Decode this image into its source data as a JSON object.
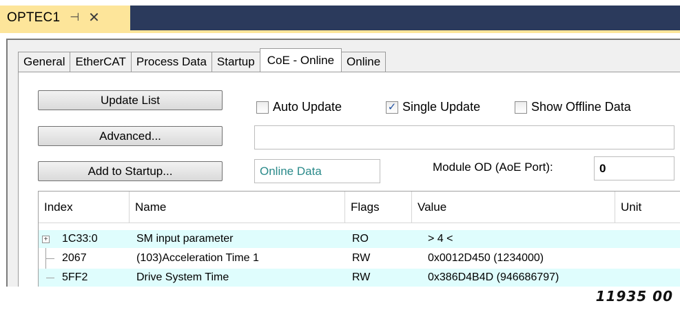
{
  "window": {
    "title": "OPTEC1",
    "pin_glyph": "⊣",
    "close_glyph": "✕"
  },
  "tabs": [
    "General",
    "EtherCAT",
    "Process Data",
    "Startup",
    "CoE - Online",
    "Online"
  ],
  "active_tab": "CoE - Online",
  "buttons": {
    "update_list": "Update List",
    "advanced": "Advanced...",
    "add_to_startup": "Add to Startup..."
  },
  "checkboxes": [
    {
      "label": "Auto Update",
      "checked": false
    },
    {
      "label": "Single Update",
      "checked": true
    },
    {
      "label": "Show Offline Data",
      "checked": false
    }
  ],
  "advanced_field": "",
  "data_source": "Online Data",
  "module_od": {
    "label": "Module OD (AoE Port):",
    "value": "0"
  },
  "table": {
    "columns": [
      "Index",
      "Name",
      "Flags",
      "Value",
      "Unit"
    ],
    "rows": [
      {
        "index": "1C33:0",
        "name": "SM input parameter",
        "flags": "RO",
        "value": "> 4 <",
        "unit": "",
        "expandable": true,
        "highlighted": true
      },
      {
        "index": "2067",
        "name": "(103)Acceleration Time 1",
        "flags": "RW",
        "value": "0x0012D450 (1234000)",
        "unit": "",
        "expandable": false,
        "highlighted": false
      },
      {
        "index": "5FF2",
        "name": "Drive System Time",
        "flags": "RW",
        "value": "0x386D4B4D (946686797)",
        "unit": "",
        "expandable": false,
        "highlighted": true
      }
    ]
  },
  "figure_id": "11935 00",
  "colors": {
    "title_bar": "#2b3a5c",
    "doc_tab": "#fde59a",
    "row_highlight": "#dffdfd",
    "data_source_text": "#2a8a8a",
    "check_mark": "#1f4fa0"
  }
}
